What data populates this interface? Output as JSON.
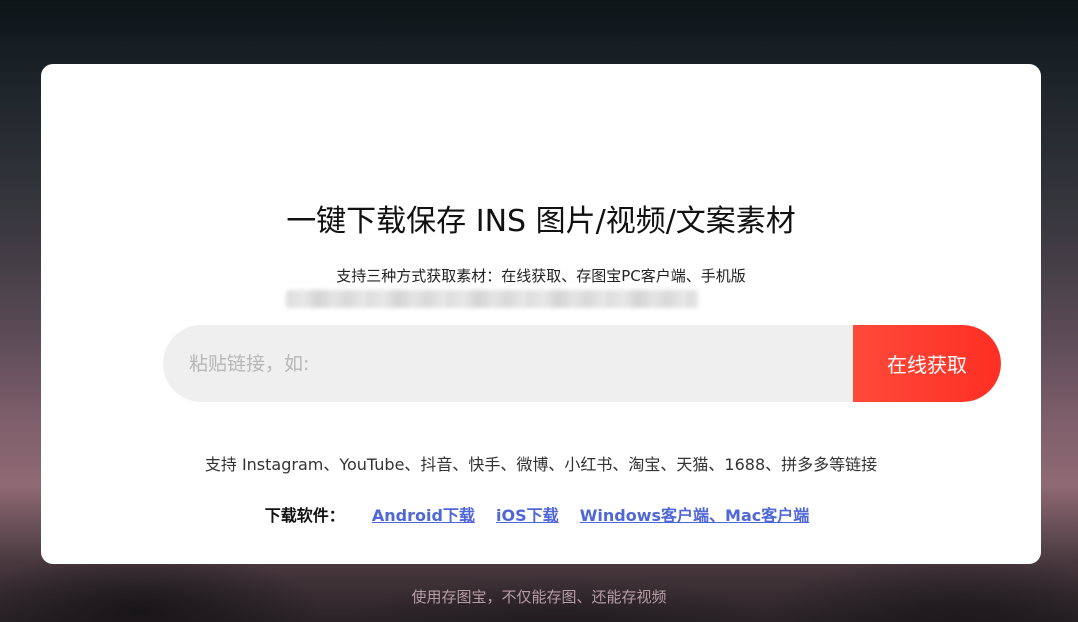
{
  "card": {
    "title": "一键下载保存 INS 图片/视频/文案素材",
    "subtitle": "支持三种方式获取素材：在线获取、存图宝PC客户端、手机版"
  },
  "search": {
    "placeholder": "粘贴链接，如:",
    "button_label": "在线获取"
  },
  "support_text": "支持 Instagram、YouTube、抖音、快手、微博、小红书、淘宝、天猫、1688、拼多多等链接",
  "downloads": {
    "label": "下载软件：",
    "links": [
      {
        "label": "Android下载"
      },
      {
        "label": "iOS下载"
      },
      {
        "label": "Windows客户端、Mac客户端"
      }
    ]
  },
  "footer": {
    "text": "使用存图宝，不仅能存图、还能存视频"
  },
  "colors": {
    "accent": "#ff3b2f",
    "link": "#4f67d8"
  }
}
